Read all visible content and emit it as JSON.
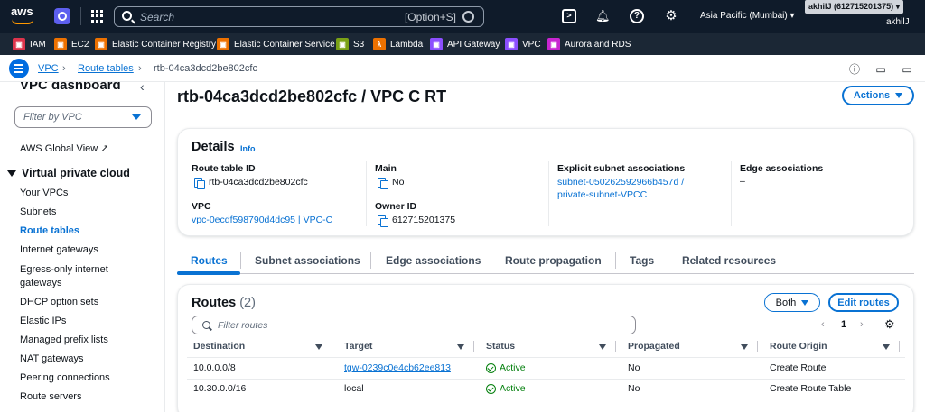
{
  "topbar": {
    "logo": "aws",
    "search_placeholder": "Search",
    "search_shortcut": "[Option+S]",
    "region": "Asia Pacific (Mumbai) ▾",
    "account_id": "akhilJ (612715201375) ▾",
    "account_name": "akhilJ"
  },
  "favorites": [
    {
      "label": "IAM",
      "color": "#dd344c",
      "icon": "iam-icon"
    },
    {
      "label": "EC2",
      "color": "#ed7100",
      "icon": "ec2-icon"
    },
    {
      "label": "Elastic Container Registry",
      "color": "#ed7100",
      "icon": "ecr-icon"
    },
    {
      "label": "Elastic Container Service",
      "color": "#ed7100",
      "icon": "ecs-icon"
    },
    {
      "label": "S3",
      "color": "#7aa116",
      "icon": "s3-icon"
    },
    {
      "label": "Lambda",
      "color": "#ed7100",
      "icon": "lambda-icon"
    },
    {
      "label": "API Gateway",
      "color": "#8c4fff",
      "icon": "api-gateway-icon"
    },
    {
      "label": "VPC",
      "color": "#8c4fff",
      "icon": "vpc-icon"
    },
    {
      "label": "Aurora and RDS",
      "color": "#c925d1",
      "icon": "rds-icon"
    }
  ],
  "breadcrumb": {
    "items": [
      "VPC",
      "Route tables",
      "rtb-04ca3dcd2be802cfc"
    ]
  },
  "sidebar": {
    "title": "VPC dashboard",
    "filter_placeholder": "Filter by VPC",
    "global_view": "AWS Global View",
    "section": "Virtual private cloud",
    "items": [
      "Your VPCs",
      "Subnets",
      "Route tables",
      "Internet gateways",
      "Egress-only internet gateways",
      "DHCP option sets",
      "Elastic IPs",
      "Managed prefix lists",
      "NAT gateways",
      "Peering connections",
      "Route servers"
    ],
    "active": "Route tables"
  },
  "page": {
    "title": "rtb-04ca3dcd2be802cfc / VPC C RT",
    "actions_label": "Actions"
  },
  "details": {
    "heading": "Details",
    "info": "Info",
    "route_table_id_label": "Route table ID",
    "route_table_id": "rtb-04ca3dcd2be802cfc",
    "vpc_label": "VPC",
    "vpc_value": "vpc-0ecdf598790d4dc95 | VPC-C",
    "main_label": "Main",
    "main_value": "No",
    "owner_label": "Owner ID",
    "owner_value": "612715201375",
    "explicit_label": "Explicit subnet associations",
    "explicit_line1": "subnet-050262592966b457d /",
    "explicit_line2": "private-subnet-VPCC",
    "edge_label": "Edge associations",
    "edge_value": "–"
  },
  "tabs": [
    "Routes",
    "Subnet associations",
    "Edge associations",
    "Route propagation",
    "Tags",
    "Related resources"
  ],
  "routes": {
    "title": "Routes",
    "count": "(2)",
    "both_label": "Both",
    "edit_label": "Edit routes",
    "filter_placeholder": "Filter routes",
    "page": "1",
    "columns": [
      "Destination",
      "Target",
      "Status",
      "Propagated",
      "Route Origin"
    ],
    "rows": [
      {
        "destination": "10.0.0.0/8",
        "target": "tgw-0239c0e4cb62ee813",
        "status": "Active",
        "propagated": "No",
        "origin": "Create Route"
      },
      {
        "destination": "10.30.0.0/16",
        "target": "local",
        "status": "Active",
        "propagated": "No",
        "origin": "Create Route Table"
      }
    ]
  }
}
